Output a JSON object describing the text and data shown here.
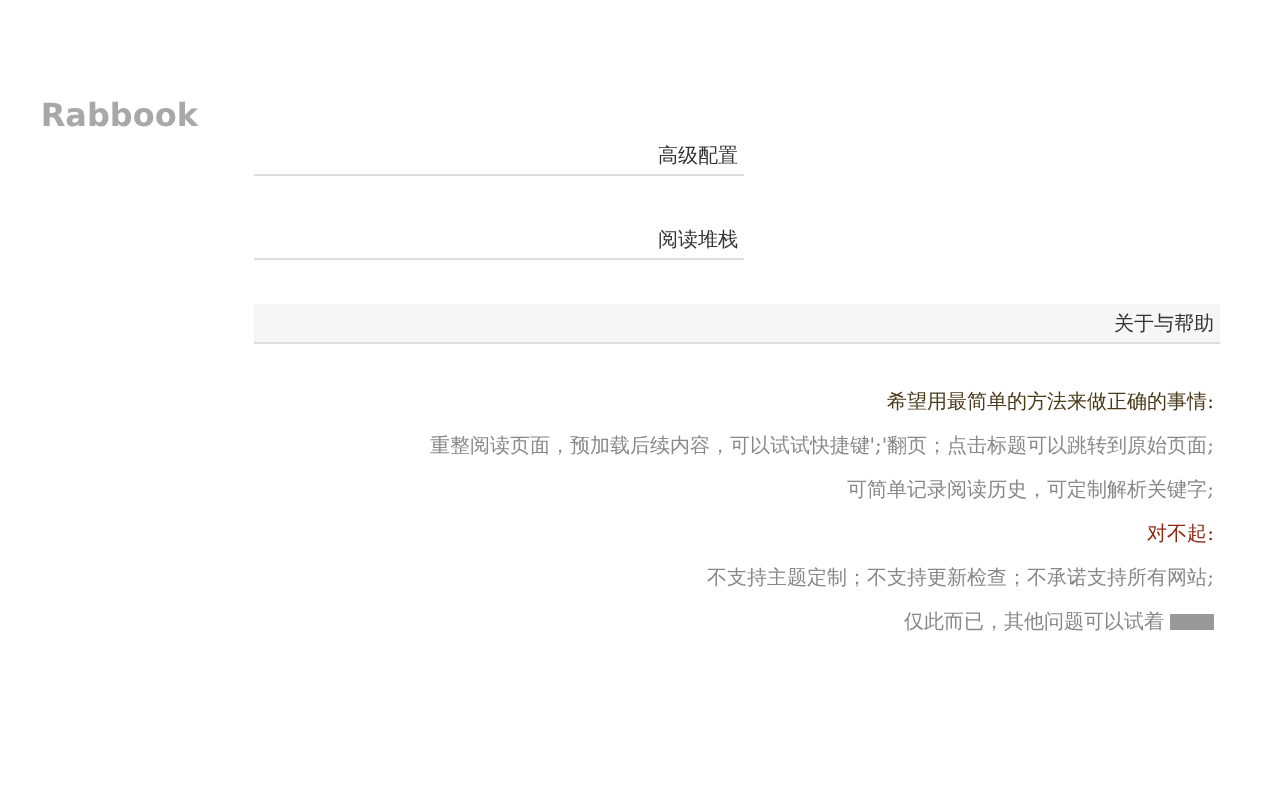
{
  "logo": "Rabbook",
  "sections": [
    {
      "title": "高级配置",
      "wide": false
    },
    {
      "title": "阅读堆栈",
      "wide": false
    },
    {
      "title": "关于与帮助",
      "wide": true
    }
  ],
  "about": [
    {
      "kind": "heading",
      "text": "希望用最简单的方法来做正确的事情:"
    },
    {
      "kind": "line",
      "text": "重整阅读页面，预加载后续内容，可以试试快捷键';'翻页；点击标题可以跳转到原始页面;"
    },
    {
      "kind": "line",
      "text": "可简单记录阅读历史，可定制解析关键字;"
    },
    {
      "kind": "warning",
      "text": "对不起:"
    },
    {
      "kind": "line",
      "text": "不支持主题定制；不支持更新检查；不承诺支持所有网站;"
    },
    {
      "kind": "line",
      "text": "仅此而已，其他问题可以试着",
      "badge": true
    }
  ]
}
